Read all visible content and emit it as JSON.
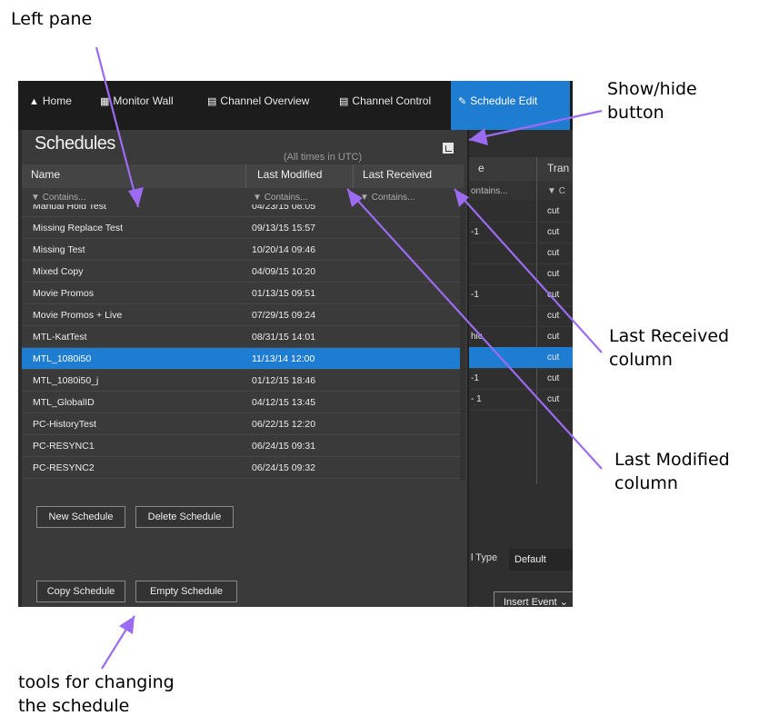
{
  "annotations": {
    "left_pane": "Left pane",
    "show_hide_line1": "Show/hide",
    "show_hide_line2": "button",
    "last_received_line1": "Last Received",
    "last_received_line2": "column",
    "last_modified_line1": "Last Modified",
    "last_modified_line2": "column",
    "tools_line1": "tools for changing",
    "tools_line2": "the schedule"
  },
  "nav": {
    "items": [
      {
        "icon": "home-icon",
        "label": "Home"
      },
      {
        "icon": "grid-icon",
        "label": "Monitor Wall"
      },
      {
        "icon": "monitor-icon",
        "label": "Channel Overview"
      },
      {
        "icon": "list-icon",
        "label": "Channel Control"
      },
      {
        "icon": "edit-icon",
        "label": "Schedule Edit"
      }
    ],
    "active": "Schedule Edit",
    "active_color": "#1f7dd1"
  },
  "schedules": {
    "title": "Schedules",
    "subtitle": "(All times in UTC)",
    "columns": [
      "Name",
      "Last Modified",
      "Last Received"
    ],
    "filter_placeholder": "Contains...",
    "rows": [
      {
        "name": "Manual Hold Test",
        "modified": "04/23/15 08:05"
      },
      {
        "name": "Missing Replace Test",
        "modified": "09/13/15 15:57"
      },
      {
        "name": "Missing Test",
        "modified": "10/20/14 09:46"
      },
      {
        "name": "Mixed Copy",
        "modified": "04/09/15 10:20"
      },
      {
        "name": "Movie Promos",
        "modified": "01/13/15 09:51"
      },
      {
        "name": "Movie Promos + Live",
        "modified": "07/29/15 09:24"
      },
      {
        "name": "MTL-KatTest",
        "modified": "08/31/15 14:01"
      },
      {
        "name": "MTL_1080i50",
        "modified": "11/13/14 12:00"
      },
      {
        "name": "MTL_1080i50_j",
        "modified": "01/12/15 18:46"
      },
      {
        "name": "MTL_GlobalID",
        "modified": "04/12/15 13:45"
      },
      {
        "name": "PC-HistoryTest",
        "modified": "06/22/15 12:20"
      },
      {
        "name": "PC-RESYNC1",
        "modified": "06/24/15 09:31"
      },
      {
        "name": "PC-RESYNC2",
        "modified": "06/24/15 09:32"
      }
    ],
    "selected_index": 7,
    "buttons": {
      "new": "New Schedule",
      "delete": "Delete Schedule",
      "copy": "Copy Schedule",
      "empty": "Empty Schedule"
    }
  },
  "background_panel": {
    "col_a": "e",
    "col_b": "Tran",
    "filter_a": "ontains...",
    "filter_b": "C",
    "rows": [
      {
        "a": "",
        "b": "cut"
      },
      {
        "a": "-1",
        "b": "cut"
      },
      {
        "a": "",
        "b": "cut"
      },
      {
        "a": "",
        "b": "cut"
      },
      {
        "a": "-1",
        "b": "cut"
      },
      {
        "a": "",
        "b": "cut"
      },
      {
        "a": "hic",
        "b": "cut"
      },
      {
        "a": "",
        "b": "cut"
      },
      {
        "a": "-1",
        "b": "cut"
      },
      {
        "a": "- 1",
        "b": "cut"
      }
    ],
    "type_label": "l Type",
    "type_value": "Default",
    "insert_event": "Insert Event"
  }
}
